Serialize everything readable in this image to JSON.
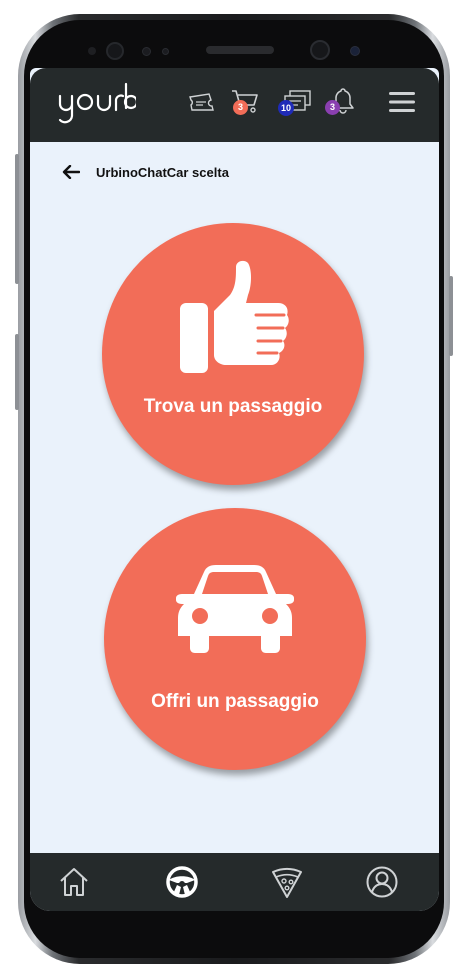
{
  "app": {
    "logo_text": "yourb"
  },
  "header": {
    "icons": [
      {
        "name": "ticket-icon"
      },
      {
        "name": "cart-icon",
        "badge": "3",
        "badge_color": "#f26d58"
      },
      {
        "name": "messages-icon",
        "badge": "10",
        "badge_color": "#1f2bb8"
      },
      {
        "name": "bell-icon",
        "badge": "3",
        "badge_color": "#8a3fb0"
      },
      {
        "name": "menu-icon"
      }
    ]
  },
  "page": {
    "back_label": "UrbinoChatCar scelta"
  },
  "actions": {
    "find_ride": {
      "label": "Trova un passaggio",
      "icon": "thumbs-up-icon"
    },
    "offer_ride": {
      "label": "Offri un passaggio",
      "icon": "car-icon"
    }
  },
  "bottom_nav": {
    "items": [
      {
        "name": "home-icon",
        "active": false
      },
      {
        "name": "steering-wheel-icon",
        "active": true
      },
      {
        "name": "pizza-icon",
        "active": false
      },
      {
        "name": "profile-icon",
        "active": false
      }
    ]
  },
  "colors": {
    "accent": "#f26d58",
    "header_bg": "#252a2b",
    "screen_bg": "#eaf2fb"
  }
}
